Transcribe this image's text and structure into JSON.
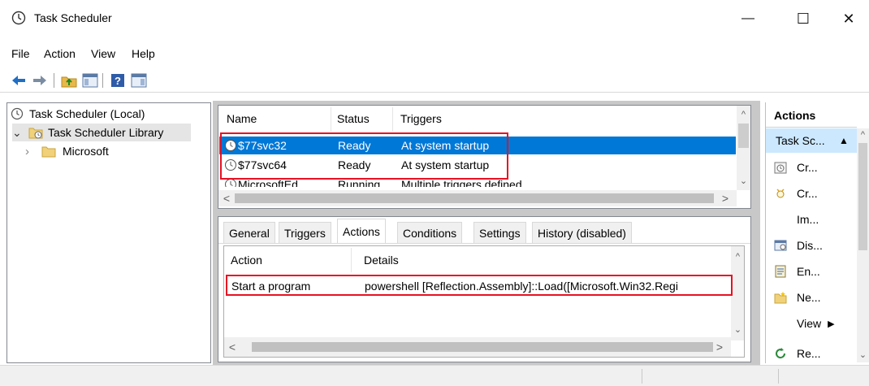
{
  "window": {
    "title": "Task Scheduler",
    "minimize_glyph": "—",
    "maximize_glyph": "☐",
    "close_glyph": "✕"
  },
  "menu": [
    "File",
    "Action",
    "View",
    "Help"
  ],
  "toolbar": {
    "icons": [
      "back-arrow-icon",
      "forward-arrow-icon",
      "up-folder-icon",
      "show-hide-tree-icon",
      "help-icon",
      "show-hide-action-pane-icon"
    ]
  },
  "tree": {
    "root": "Task Scheduler (Local)",
    "library": "Task Scheduler Library",
    "child": "Microsoft",
    "expanded_glyph": "⌄",
    "collapsed_glyph": "›"
  },
  "task_list": {
    "columns": [
      "Name",
      "Status",
      "Triggers"
    ],
    "rows": [
      {
        "name": "$77svc32",
        "status": "Ready",
        "triggers": "At system startup",
        "selected": true
      },
      {
        "name": "$77svc64",
        "status": "Ready",
        "triggers": "At system startup",
        "selected": false
      },
      {
        "name": "MicrosoftEd",
        "status": "Running",
        "triggers": "Multiple triggers defined",
        "selected": false
      }
    ]
  },
  "details": {
    "tabs": [
      "General",
      "Triggers",
      "Actions",
      "Conditions",
      "Settings",
      "History (disabled)"
    ],
    "active_tab": "Actions",
    "columns": [
      "Action",
      "Details"
    ],
    "rows": [
      {
        "action": "Start a program",
        "details": "powershell [Reflection.Assembly]::Load([Microsoft.Win32.Regi"
      }
    ]
  },
  "actions_pane": {
    "header": "Actions",
    "section": "Task Sc...",
    "section_glyph": "▲",
    "items": [
      {
        "label": "Cr...",
        "icon": "create-basic-task-icon"
      },
      {
        "label": "Cr...",
        "icon": "create-task-icon"
      },
      {
        "label": "Im...",
        "icon": ""
      },
      {
        "label": "Dis...",
        "icon": "display-running-tasks-icon"
      },
      {
        "label": "En...",
        "icon": "enable-history-icon"
      },
      {
        "label": "Ne...",
        "icon": "new-folder-icon"
      },
      {
        "label": "View",
        "icon": "",
        "submenu_glyph": "▶"
      },
      {
        "label": "Re...",
        "icon": "refresh-icon"
      }
    ]
  },
  "scroll_glyphs": {
    "up": "^",
    "down": "⌄",
    "left": "<",
    "right": ">"
  },
  "colors": {
    "selection": "#0078d7",
    "highlight_box": "#e81123",
    "actions_section_bg": "#cce8ff"
  }
}
